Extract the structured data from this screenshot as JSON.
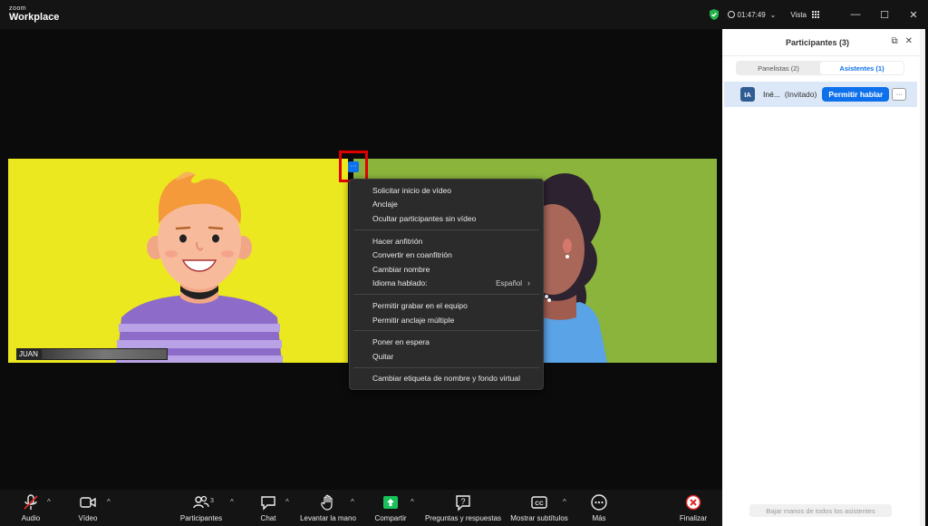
{
  "window": {
    "logo_small": "zoom",
    "logo_big": "Workplace",
    "timer": "01:47:49",
    "view_label": "Vista",
    "minimize_glyph": "—",
    "maximize_glyph": "☐",
    "close_glyph": "✕"
  },
  "video": {
    "tile1_name": "JUAN",
    "more_glyph": "···"
  },
  "menu": {
    "groups": [
      [
        "Solicitar inicio de vídeo",
        "Anclaje",
        "Ocultar participantes sin vídeo"
      ],
      [
        "Hacer anfitrión",
        "Convertir en coanfitrión",
        "Cambiar nombre",
        "Idioma hablado:"
      ],
      [
        "Permitir grabar en el equipo",
        "Permitir anclaje múltiple"
      ],
      [
        "Poner en espera",
        "Quitar"
      ],
      [
        "Cambiar etiqueta de nombre y fondo virtual"
      ]
    ],
    "language_value": "Español",
    "submenu_arrow": "›"
  },
  "panel": {
    "title": "Participantes (3)",
    "popout_icon": "⧉",
    "close_icon": "✕",
    "tabs": [
      "Panelistas (2)",
      "Asistentes (1)"
    ],
    "attendee": {
      "initials": "IA",
      "name": "Iné...",
      "role": "(Invitado)",
      "allow_label": "Permitir hablar",
      "more_label": "···"
    },
    "lower_hands_label": "Bajar manos de todos los asistentes"
  },
  "toolbar": {
    "audio": "Audio",
    "video": "Vídeo",
    "participants": "Participantes",
    "participants_count": "3",
    "chat": "Chat",
    "raise_hand": "Levantar la mano",
    "share": "Compartir",
    "qa": "Preguntas y respuestas",
    "captions": "Mostrar subtítulos",
    "more": "Más",
    "end": "Finalizar",
    "caret": "^"
  },
  "colors": {
    "accent": "#0e71eb",
    "highlight_box": "#e00000",
    "tile_yellow": "#ece81f",
    "tile_green": "#8ab43c",
    "share_green": "#18c25a",
    "end_red": "#e02828"
  }
}
